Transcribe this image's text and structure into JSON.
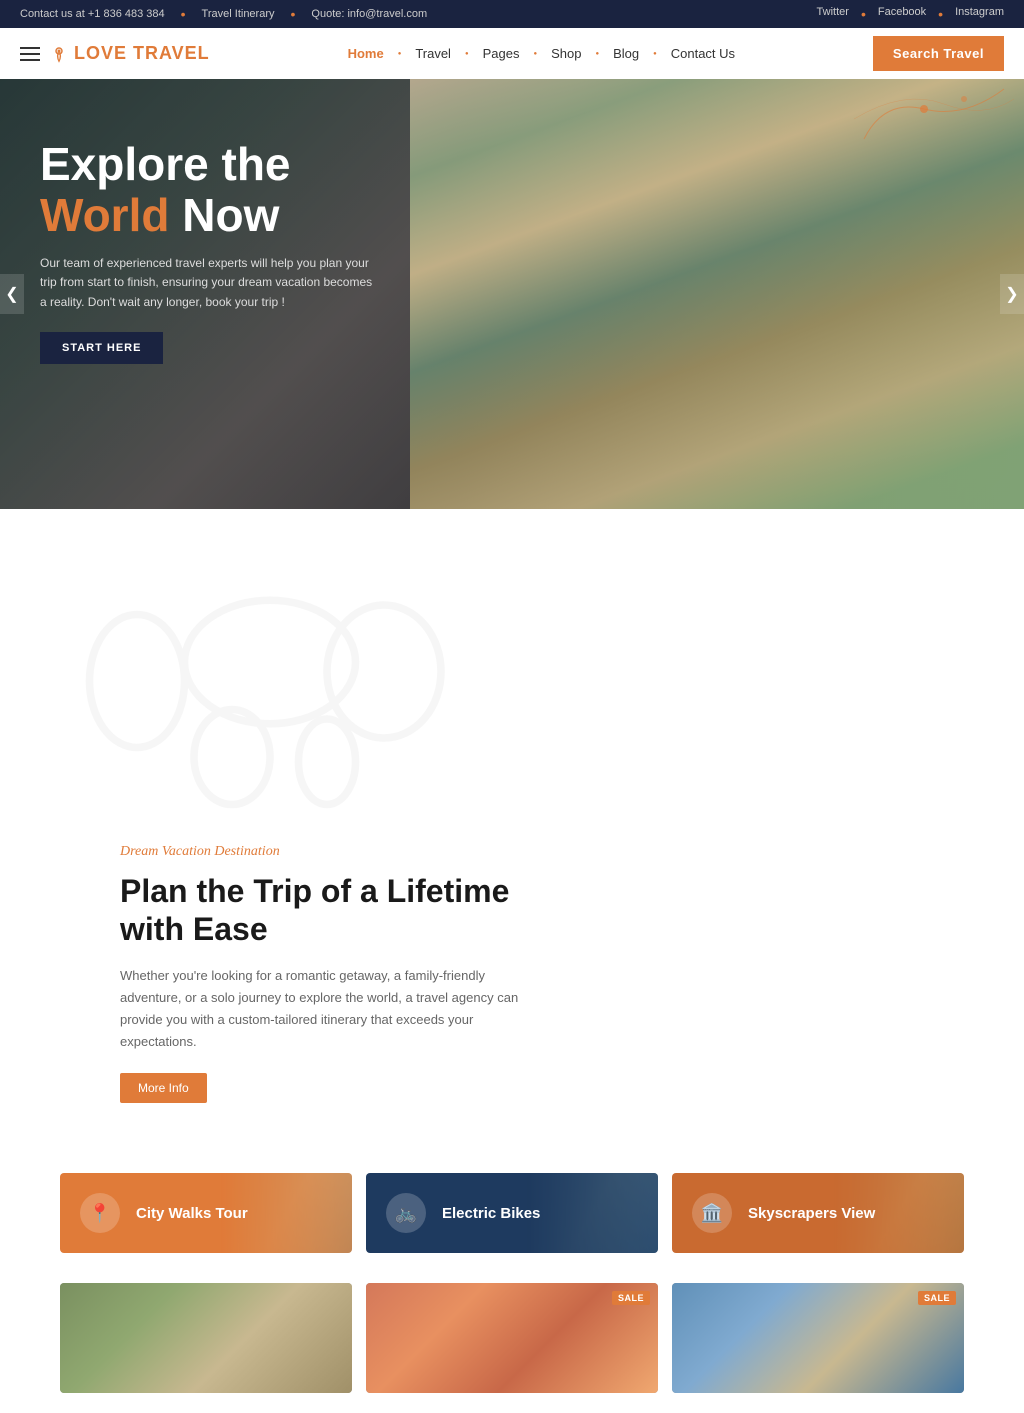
{
  "topbar": {
    "contact": "Contact us at +1 836 483 384",
    "itinerary": "Travel Itinerary",
    "quote": "Quote: info@travel.com",
    "social": {
      "twitter": "Twitter",
      "facebook": "Facebook",
      "instagram": "Instagram"
    }
  },
  "logo": {
    "text_love": "Love",
    "text_travel": " Travel"
  },
  "nav": {
    "items": [
      {
        "label": "Home",
        "active": true
      },
      {
        "label": "Travel",
        "active": false
      },
      {
        "label": "Pages",
        "active": false
      },
      {
        "label": "Shop",
        "active": false
      },
      {
        "label": "Blog",
        "active": false
      },
      {
        "label": "Contact Us",
        "active": false
      }
    ],
    "search_button": "Search Travel"
  },
  "hero": {
    "title_line1": "Explore the",
    "title_orange": "World",
    "title_white": " Now",
    "subtitle": "Our team of experienced travel experts will help you plan your trip from start to finish, ensuring your dream vacation becomes a reality. Don't wait any longer, book your trip !",
    "cta_button": "START HERE",
    "arrow_left": "❮",
    "arrow_right": "❯"
  },
  "plan_section": {
    "tag": "Dream Vacation Destination",
    "title": "Plan the Trip of a Lifetime with Ease",
    "description": "Whether you're looking for a romantic getaway, a family-friendly adventure, or a solo journey to explore the world, a travel agency can provide you with a custom-tailored itinerary that exceeds your expectations.",
    "more_info_button": "More Info"
  },
  "tour_cards": [
    {
      "label": "City Walks Tour",
      "icon": "📍",
      "type": "orange"
    },
    {
      "label": "Electric Bikes",
      "icon": "🚲",
      "type": "dark-blue"
    },
    {
      "label": "Skyscrapers View",
      "icon": "🏛️",
      "type": "orange-2"
    }
  ],
  "bottom_cards": [
    {
      "has_sale": false,
      "type": "card1"
    },
    {
      "has_sale": true,
      "type": "card2"
    },
    {
      "has_sale": true,
      "type": "card3"
    }
  ],
  "sale_badge_text": "SALE"
}
